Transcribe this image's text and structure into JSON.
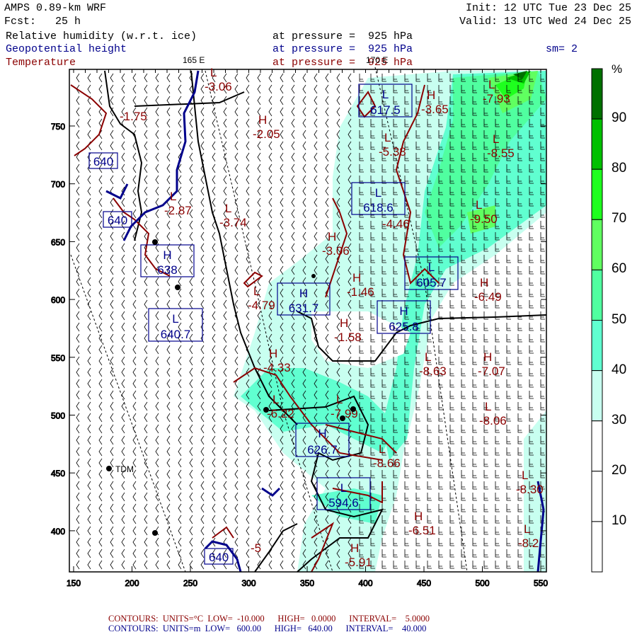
{
  "header": {
    "model": "AMPS 0.89-km WRF",
    "forecast": "Fcst:   25 h",
    "init": "Init: 12 UTC Tue 23 Dec 25",
    "valid": "Valid: 13 UTC Wed 24 Dec 25",
    "fields": [
      {
        "name": "Relative humidity (w.r.t. ice)",
        "level": "at pressure =  925 hPa",
        "color": "#000000"
      },
      {
        "name": "Geopotential height",
        "level": "at pressure =  925 hPa",
        "color": "#00008b"
      },
      {
        "name": "Temperature",
        "level": "at pressure =  925 hPa",
        "color": "#8b0000"
      }
    ],
    "smoothing": "sm= 2",
    "lon_labels": [
      "165 E",
      "170 E"
    ]
  },
  "axes": {
    "x_ticks": [
      "150",
      "200",
      "250",
      "300",
      "350",
      "400",
      "450",
      "500",
      "550"
    ],
    "y_ticks": [
      "750",
      "700",
      "650",
      "600",
      "550",
      "500",
      "450",
      "400"
    ]
  },
  "colorbar": {
    "unit": "%",
    "labels": [
      "90",
      "80",
      "70",
      "60",
      "50",
      "40",
      "30",
      "20",
      "10"
    ],
    "colors": [
      "#007000",
      "#00c000",
      "#1eff1e",
      "#60ff60",
      "#50ffa0",
      "#60ffd0",
      "#c8fff0",
      "#ffffff",
      "#ffffff",
      "#ffffff"
    ]
  },
  "station": {
    "name": "TDM"
  },
  "temperature_labels": [
    {
      "type": "L",
      "value": "-3.06"
    },
    {
      "type": "",
      "value": "-1.75"
    },
    {
      "type": "H",
      "value": "-2.05"
    },
    {
      "type": "L",
      "value": "-2.87"
    },
    {
      "type": "L",
      "value": "-3.74"
    },
    {
      "type": "H",
      "value": "-3.06"
    },
    {
      "type": "L",
      "value": "-4.79"
    },
    {
      "type": "H",
      "value": "-1.46"
    },
    {
      "type": "H",
      "value": "-1.58"
    },
    {
      "type": "H",
      "value": "-3.65"
    },
    {
      "type": "L",
      "value": "-5.38"
    },
    {
      "type": "L",
      "value": "-7.93"
    },
    {
      "type": "L",
      "value": "-8.55"
    },
    {
      "type": "",
      "value": "-4.46"
    },
    {
      "type": "L",
      "value": "-9.50"
    },
    {
      "type": "H",
      "value": "-6.49"
    },
    {
      "type": "H",
      "value": "-4.33"
    },
    {
      "type": "L",
      "value": "-6.22"
    },
    {
      "type": "L",
      "value": "-7.99"
    },
    {
      "type": "L",
      "value": "-8.63"
    },
    {
      "type": "H",
      "value": "-7.07"
    },
    {
      "type": "L",
      "value": "-8.06"
    },
    {
      "type": "L",
      "value": "-8.66"
    },
    {
      "type": "H",
      "value": "-6.51"
    },
    {
      "type": "L",
      "value": "-8.30"
    },
    {
      "type": "L",
      "value": "-8.2"
    },
    {
      "type": "H",
      "value": "-5.91"
    },
    {
      "type": "",
      "value": "-5"
    }
  ],
  "height_labels": [
    {
      "type": "",
      "value": "640"
    },
    {
      "type": "",
      "value": "640"
    },
    {
      "type": "H",
      "value": "638"
    },
    {
      "type": "L",
      "value": "640.7"
    },
    {
      "type": "H",
      "value": "631.7"
    },
    {
      "type": "L",
      "value": "617.5"
    },
    {
      "type": "L",
      "value": "618.6"
    },
    {
      "type": "L",
      "value": "605.7"
    },
    {
      "type": "H",
      "value": "625.8"
    },
    {
      "type": "H",
      "value": "626.7"
    },
    {
      "type": "L",
      "value": "594.6"
    },
    {
      "type": "",
      "value": "640"
    }
  ],
  "footer": {
    "temp": {
      "label": "CONTOURS:",
      "units": "UNITS=°C",
      "low": "LOW=  -10.000",
      "high": "HIGH=   0.0000",
      "interval": "INTERVAL=    5.0000"
    },
    "height": {
      "label": "CONTOURS:",
      "units": "UNITS=m",
      "low": "LOW=   600.00",
      "high": "HIGH=   640.00",
      "interval": "INTERVAL=    40.000"
    }
  }
}
